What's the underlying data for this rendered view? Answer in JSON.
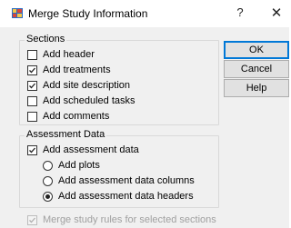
{
  "window": {
    "title": "Merge Study Information",
    "help_glyph": "?",
    "close_glyph": "✕",
    "app_icon": "grid-app-icon"
  },
  "sections": {
    "label": "Sections",
    "items": [
      {
        "label": "Add header",
        "checked": false
      },
      {
        "label": "Add treatments",
        "checked": true
      },
      {
        "label": "Add site description",
        "checked": true
      },
      {
        "label": "Add scheduled tasks",
        "checked": false
      },
      {
        "label": "Add comments",
        "checked": false
      }
    ]
  },
  "assessment": {
    "label": "Assessment Data",
    "checkbox": {
      "label": "Add assessment data",
      "checked": true
    },
    "options": [
      {
        "label": "Add plots",
        "selected": false
      },
      {
        "label": "Add assessment data columns",
        "selected": false
      },
      {
        "label": "Add assessment data headers",
        "selected": true
      }
    ]
  },
  "merge_rules": {
    "label": "Merge study rules for selected sections",
    "checked": true,
    "disabled": true
  },
  "buttons": {
    "ok": "OK",
    "cancel": "Cancel",
    "help": "Help"
  }
}
